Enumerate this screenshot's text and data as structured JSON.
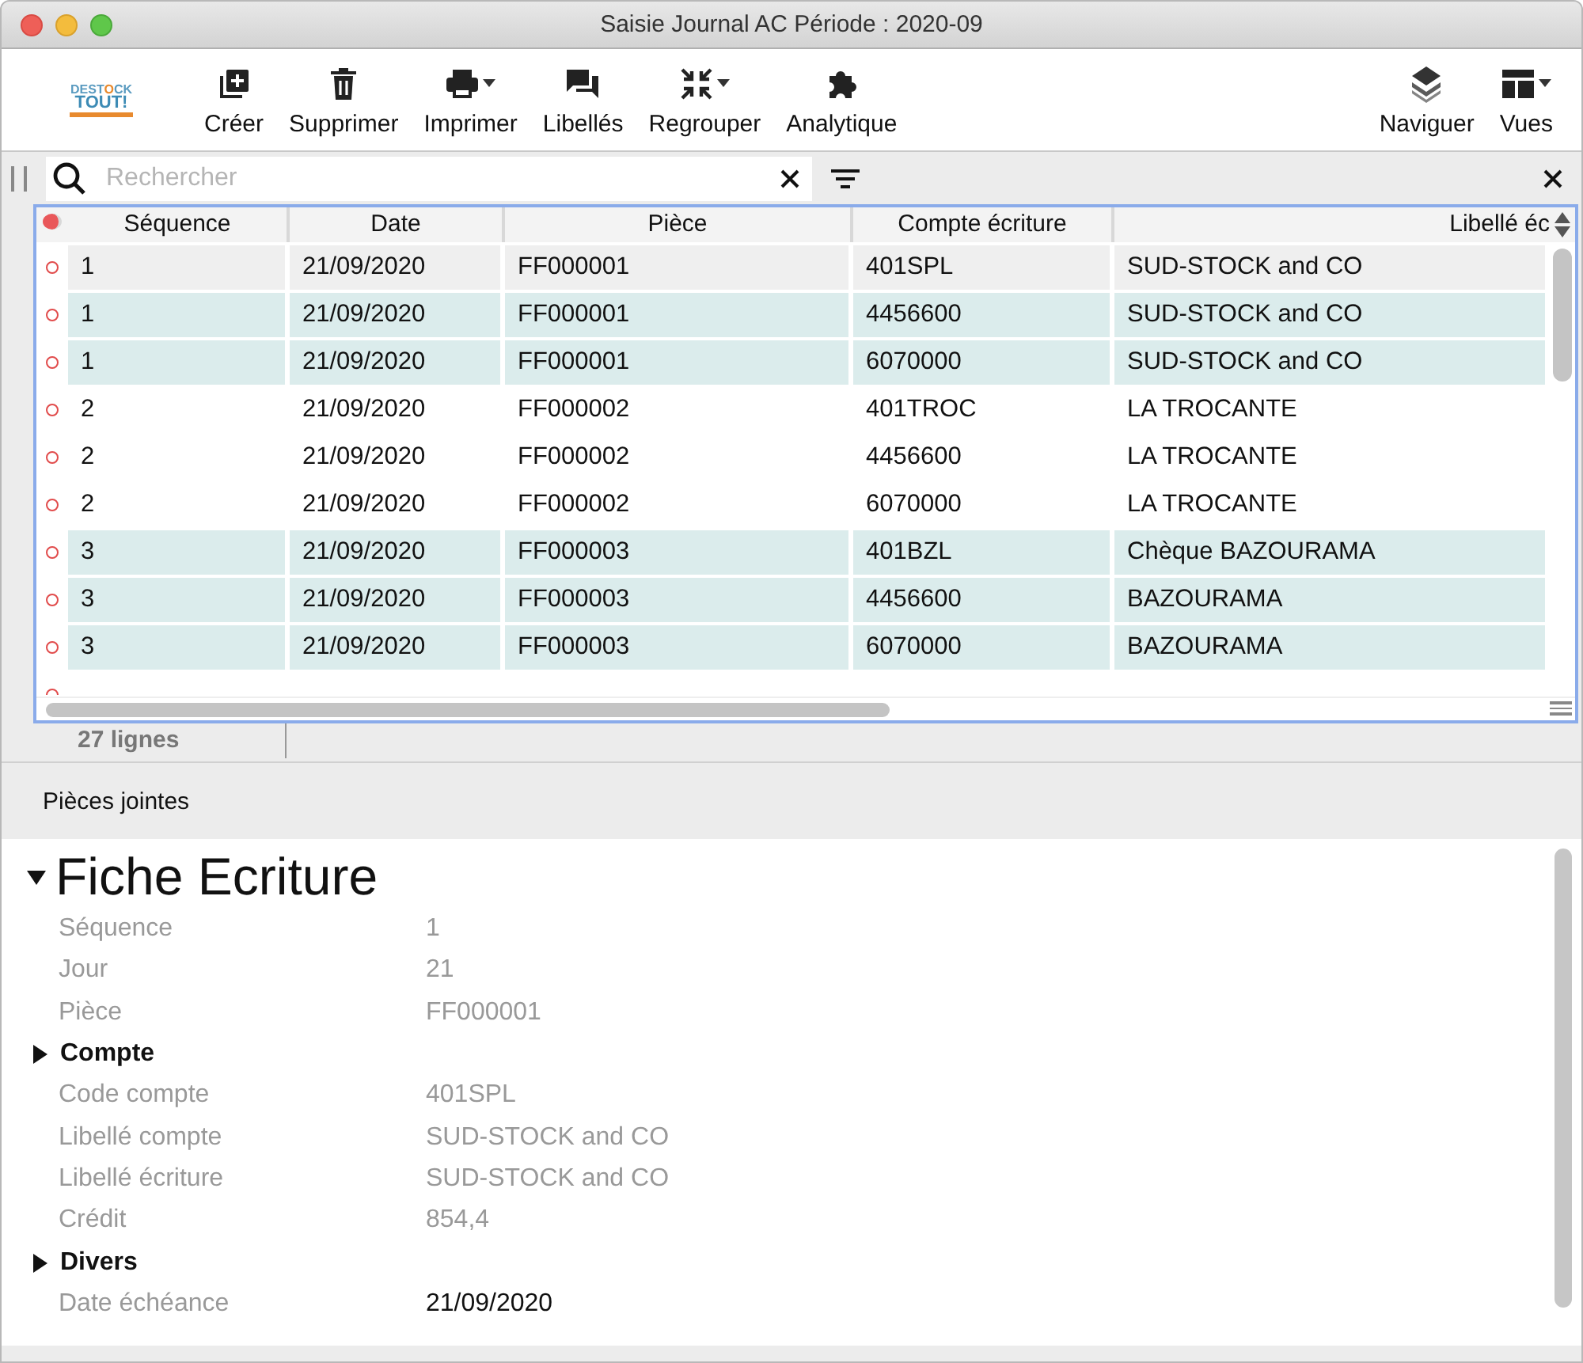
{
  "window": {
    "title": "Saisie Journal AC Période : 2020-09"
  },
  "logo": {
    "line1": "DEST",
    "mark": "O",
    "line1b": "CK",
    "line2": "TOUT!"
  },
  "toolbar": [
    {
      "label": "Créer",
      "menu": false
    },
    {
      "label": "Supprimer",
      "menu": false
    },
    {
      "label": "Imprimer",
      "menu": true
    },
    {
      "label": "Libellés",
      "menu": false
    },
    {
      "label": "Regrouper",
      "menu": true
    },
    {
      "label": "Analytique",
      "menu": false
    },
    {
      "label": "Naviguer",
      "menu": false
    },
    {
      "label": "Vues",
      "menu": true
    }
  ],
  "search": {
    "placeholder": "Rechercher"
  },
  "table": {
    "columns": [
      "Séquence",
      "Date",
      "Pièce",
      "Compte écriture",
      "Libellé éc"
    ],
    "rows": [
      {
        "cells": [
          "1",
          "21/09/2020",
          "FF000001",
          "401SPL",
          "SUD-STOCK and CO"
        ],
        "shaded": true,
        "selected": true
      },
      {
        "cells": [
          "1",
          "21/09/2020",
          "FF000001",
          "4456600",
          "SUD-STOCK and CO"
        ],
        "shaded": true,
        "selected": false
      },
      {
        "cells": [
          "1",
          "21/09/2020",
          "FF000001",
          "6070000",
          "SUD-STOCK and CO"
        ],
        "shaded": true,
        "selected": false
      },
      {
        "cells": [
          "2",
          "21/09/2020",
          "FF000002",
          "401TROC",
          "LA TROCANTE"
        ],
        "shaded": false,
        "selected": false
      },
      {
        "cells": [
          "2",
          "21/09/2020",
          "FF000002",
          "4456600",
          "LA TROCANTE"
        ],
        "shaded": false,
        "selected": false
      },
      {
        "cells": [
          "2",
          "21/09/2020",
          "FF000002",
          "6070000",
          "LA TROCANTE"
        ],
        "shaded": false,
        "selected": false
      },
      {
        "cells": [
          "3",
          "21/09/2020",
          "FF000003",
          "401BZL",
          "Chèque BAZOURAMA"
        ],
        "shaded": true,
        "selected": false
      },
      {
        "cells": [
          "3",
          "21/09/2020",
          "FF000003",
          "4456600",
          "BAZOURAMA"
        ],
        "shaded": true,
        "selected": false
      },
      {
        "cells": [
          "3",
          "21/09/2020",
          "FF000003",
          "6070000",
          "BAZOURAMA"
        ],
        "shaded": true,
        "selected": false
      }
    ],
    "footer": "27 lignes"
  },
  "attachments": {
    "label": "Pièces jointes"
  },
  "detail": {
    "title": "Fiche Ecriture",
    "expanded": true,
    "items": [
      {
        "kind": "field",
        "label": "Séquence",
        "value": "1",
        "disabled": true
      },
      {
        "kind": "field",
        "label": "Jour",
        "value": "21",
        "disabled": true
      },
      {
        "kind": "field",
        "label": "Pièce",
        "value": "FF000001",
        "disabled": true
      },
      {
        "kind": "section",
        "label": "Compte",
        "expanded": false
      },
      {
        "kind": "field",
        "label": "Code compte",
        "value": "401SPL",
        "disabled": true
      },
      {
        "kind": "field",
        "label": "Libellé compte",
        "value": "SUD-STOCK and CO",
        "disabled": true
      },
      {
        "kind": "field",
        "label": "Libellé écriture",
        "value": "SUD-STOCK and CO",
        "disabled": true
      },
      {
        "kind": "field",
        "label": "Crédit",
        "value": "854,4",
        "disabled": true
      },
      {
        "kind": "section",
        "label": "Divers",
        "expanded": false
      },
      {
        "kind": "field",
        "label": "Date échéance",
        "value": "21/09/2020",
        "disabled": false
      }
    ]
  }
}
